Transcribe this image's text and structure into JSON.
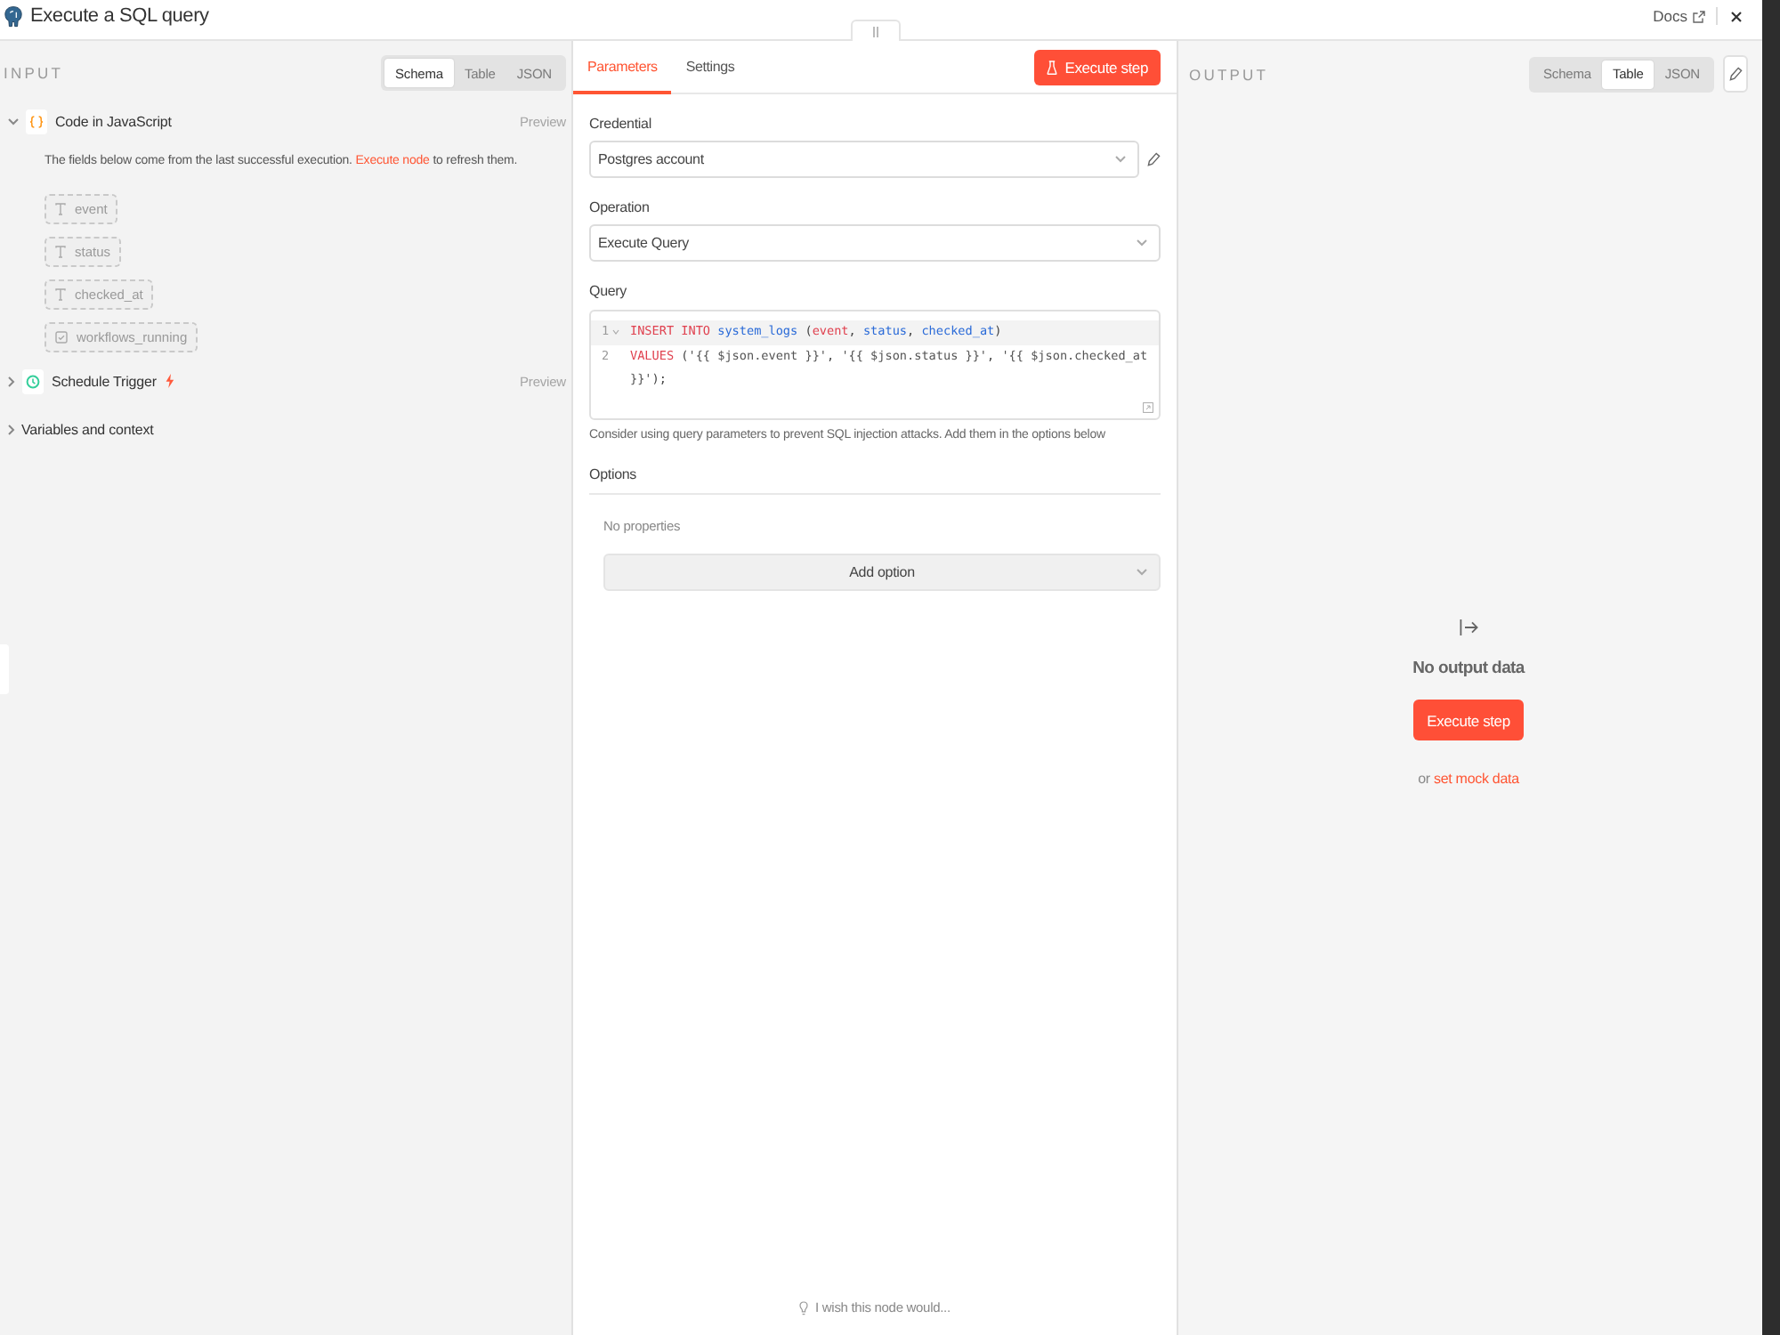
{
  "header": {
    "title": "Execute a SQL query",
    "docs_link": "Docs"
  },
  "input_panel": {
    "heading": "INPUT",
    "view_tabs": [
      {
        "label": "Schema",
        "selected": true
      },
      {
        "label": "Table",
        "selected": false
      },
      {
        "label": "JSON",
        "selected": false
      }
    ],
    "nodes": [
      {
        "kind": "code",
        "name": "Code in JavaScript",
        "expanded": true,
        "preview": "Preview",
        "notice": {
          "text": "The fields below come from the last successful execution.",
          "link": "Execute node",
          "tail": "to refresh them."
        },
        "fields": [
          {
            "kind": "string",
            "name": "event"
          },
          {
            "kind": "string",
            "name": "status"
          },
          {
            "kind": "string",
            "name": "checked_at"
          },
          {
            "kind": "boolean",
            "name": "workflows_running"
          }
        ]
      },
      {
        "kind": "trigger",
        "name": "Schedule Trigger",
        "expanded": false,
        "preview": "Preview"
      }
    ],
    "variables_context": {
      "label": "Variables and context",
      "expanded": false
    }
  },
  "parameters_panel": {
    "tabs": [
      {
        "label": "Parameters",
        "selected": true
      },
      {
        "label": "Settings",
        "selected": false
      }
    ],
    "execute_button": "Execute step",
    "credential": {
      "label": "Credential",
      "value": "Postgres account"
    },
    "operation": {
      "label": "Operation",
      "value": "Execute Query"
    },
    "query": {
      "label": "Query",
      "lines": [
        {
          "number": "1",
          "foldable": true,
          "active": true,
          "tokens": [
            {
              "kind": "keyword",
              "text": "INSERT INTO"
            },
            {
              "kind": "identifier",
              "text": " system_logs"
            },
            {
              "kind": "punct",
              "text": " ("
            },
            {
              "kind": "keyword",
              "text": "event"
            },
            {
              "kind": "punct",
              "text": ", "
            },
            {
              "kind": "identifier",
              "text": "status"
            },
            {
              "kind": "punct",
              "text": ", "
            },
            {
              "kind": "identifier",
              "text": "checked_at"
            },
            {
              "kind": "punct",
              "text": ")"
            }
          ]
        },
        {
          "number": "2",
          "foldable": false,
          "active": false,
          "tokens": [
            {
              "kind": "keyword",
              "text": "VALUES"
            },
            {
              "kind": "punct",
              "text": " ("
            },
            {
              "kind": "string",
              "text": "'{{ $json.event }}'"
            },
            {
              "kind": "punct",
              "text": ", "
            },
            {
              "kind": "string",
              "text": "'{{ $json.status }}'"
            },
            {
              "kind": "punct",
              "text": ", "
            },
            {
              "kind": "string",
              "text": "'{{ $json.checked_at }}'"
            },
            {
              "kind": "punct",
              "text": ");"
            }
          ]
        }
      ],
      "hint": "Consider using query parameters to prevent SQL injection attacks. Add them in the options below"
    },
    "options": {
      "label": "Options",
      "empty_text": "No properties",
      "add_button": "Add option"
    },
    "feedback": "I wish this node would..."
  },
  "output_panel": {
    "heading": "OUTPUT",
    "view_tabs": [
      {
        "label": "Schema",
        "selected": false
      },
      {
        "label": "Table",
        "selected": true
      },
      {
        "label": "JSON",
        "selected": false
      }
    ],
    "empty_title": "No output data",
    "execute_button": "Execute step",
    "mock_text": "or",
    "mock_link": "set mock data"
  }
}
